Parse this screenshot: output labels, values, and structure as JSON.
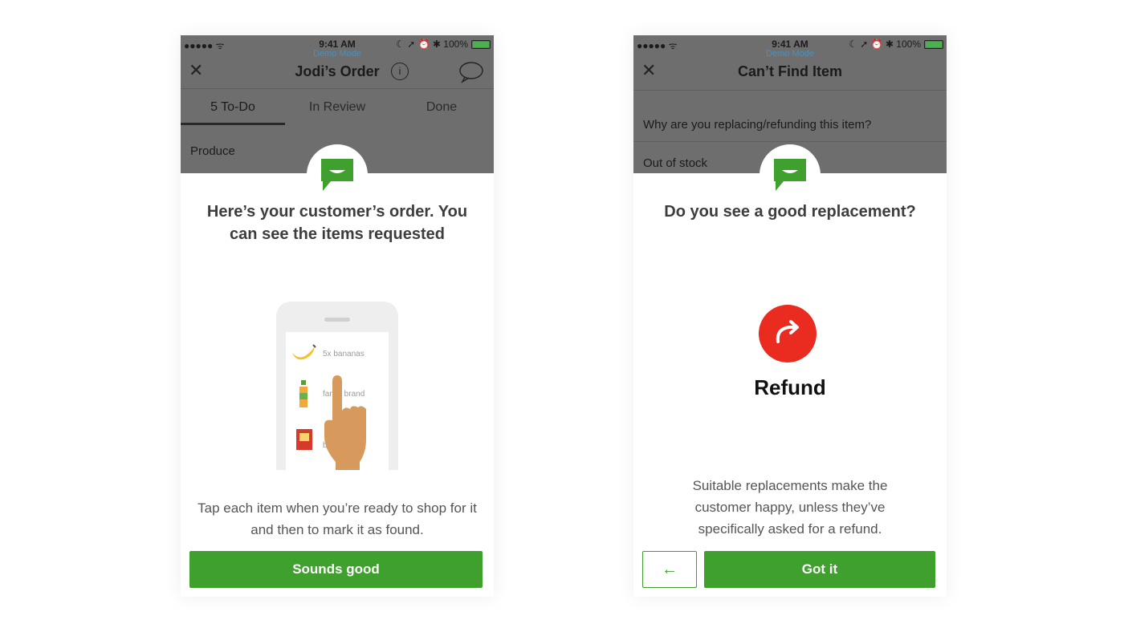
{
  "status_bar": {
    "signal": "●●●●● ᯤ",
    "time": "9:41 AM",
    "right": "☾ ➚ ⏰ ✱ 100%"
  },
  "demo_mode": "Demo Mode",
  "screen1": {
    "nav": {
      "close": "✕",
      "title": "Jodi’s Order",
      "info": "i",
      "chat_icon": "chat-bubble-icon"
    },
    "tabs": [
      "5 To-Do",
      "In Review",
      "Done"
    ],
    "section": "Produce",
    "headline": "Here’s your customer’s order. You can see the items requested",
    "illustration_items": [
      "5x bananas",
      "fancy brand",
      "b     p"
    ],
    "description": "Tap each item when you’re ready to shop for it and then to mark it as found.",
    "button": "Sounds good"
  },
  "screen2": {
    "nav": {
      "close": "✕",
      "title": "Can’t Find Item"
    },
    "question": "Why are you replacing/refunding this item?",
    "answer": "Out of stock",
    "headline": "Do you see a good replacement?",
    "refund_label": "Refund",
    "description": "Suitable replacements make the customer happy, unless they’ve specifically asked for a refund.",
    "back_button": "←",
    "button": "Got it"
  },
  "colors": {
    "accent_green": "#3fa02d",
    "refund_red": "#ea2b1f",
    "overlay_gray": "#6e6e6e"
  }
}
